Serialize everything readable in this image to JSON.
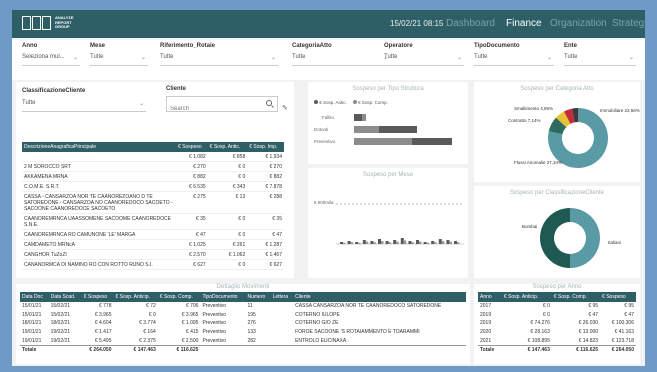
{
  "header": {
    "date": "15/02/21 08:15",
    "nav": [
      "Dashboard",
      "Finance",
      "Organization",
      "Strategy"
    ],
    "logo_line1": "ANALYZE",
    "logo_line2": "REPORT",
    "logo_line3": "GROUP"
  },
  "filters": [
    {
      "label": "Anno",
      "value": "Seleziona mul..."
    },
    {
      "label": "Mese",
      "value": "Tutte"
    },
    {
      "label": "Riferimento_Rotaie",
      "value": "Tutte"
    },
    {
      "label": "CategoriaAtto",
      "value": "Tutte"
    },
    {
      "label": "Operatore",
      "value": "Tutte"
    },
    {
      "label": "TipoDocumento",
      "value": "Tutte"
    },
    {
      "label": "Ente",
      "value": "Tutte"
    }
  ],
  "classificazione": {
    "label": "ClassificazioneCliente",
    "value": "Tutte"
  },
  "cliente": {
    "label": "Cliente",
    "placeholder": "Search"
  },
  "table1": {
    "headers": [
      "DescrizioneAnagraficaPrincipale",
      "€ Sospeso",
      "€ Sosp. Antic.",
      "€ Sosp. Imp."
    ],
    "rows": [
      [
        "",
        "€ 1.082",
        "€ 858",
        "€ 1.934"
      ],
      [
        "2 M SOROCCO SRT",
        "€ 270",
        "€ 0",
        "€ 270"
      ],
      [
        "AKKAMENA MRNA",
        "€ 882",
        "€ 0",
        "€ 882"
      ],
      [
        "C.O.M.E. S.R.T.",
        "€ 6.535",
        "€ 343",
        "€ 7.878"
      ],
      [
        "CASSA - CANSARZOA NOR TE CAANOREZOANO D TE SATOREDONE - CANSARZOA NO CAANOREDOCO SACOETO - SACOONE CAANOREDOCE SACOETO",
        "€ 275",
        "€ 13",
        "€ 288"
      ],
      [
        "CAANOREMRNCA UAASSOMENE SACOOME CAANOREDOCE S.N.E.",
        "€ 35",
        "€ 0",
        "€ 35"
      ],
      [
        "CAANOREMRNCA RO CAMUNONE 'LE' MARGA",
        "€ 47",
        "€ 0",
        "€ 47"
      ],
      [
        "CAMDAMETO MRNcA",
        "€ 1.025",
        "€ 261",
        "€ 1.287"
      ],
      [
        "CANGHOR TuZoZI",
        "€ 2.570",
        "€ 1.062",
        "€ 1.467"
      ],
      [
        "CANANORMCA DI NAMINO RO CON ROTTO RUNO S.I.",
        "€ 627",
        "€ 0",
        "€ 627"
      ]
    ]
  },
  "tipo_struttura": {
    "title": "Sospeso per Tipo Struttura",
    "legend": [
      "€ Sosp. Antic.",
      "€ Sosp. Comp."
    ],
    "colors": [
      "#5a5a5a",
      "#8c8c8c"
    ]
  },
  "categoria_atto": {
    "title": "Sospeso per Categoria Atto",
    "labels": [
      "Smaltimento 4,85%",
      "Immobiliare 22,56%",
      "Contratto 7,14%",
      "Flussi Anomalie 27,34%"
    ]
  },
  "mese": {
    "title": "Sospeso per Mese",
    "ylabel": "€ 500mila"
  },
  "classificazione_chart": {
    "title": "Sospeso per ClassificazioneCliente",
    "labels": [
      "Bombai",
      "Italiani"
    ]
  },
  "dettaglio": {
    "title": "Dettaglio Movimenti",
    "headers": [
      "Data Doc",
      "Data Scad.",
      "€ Sospeso",
      "€ Sosp. Anticip.",
      "€ Sosp. Comp.",
      "TipoDocumento",
      "Numero",
      "Lettera",
      "Cliente"
    ],
    "rows": [
      [
        "15/01/21",
        "15/02/21",
        "€ 778",
        "€ 72",
        "€ 706",
        "Preventivo",
        "11",
        "",
        "CASSA CANSARZOA NOR TE CAANOREDOCO SATOREDONE"
      ],
      [
        "15/01/21",
        "15/02/21",
        "€ 3.965",
        "€ 0",
        "€ 3.965",
        "Preventivo",
        "195",
        "",
        "COTERNO IULOPE"
      ],
      [
        "18/01/21",
        "18/02/21",
        "€ 4.604",
        "€ 3.774",
        "€ 1.095",
        "Preventivo",
        "276",
        "",
        "COTERNO GIO ZE"
      ],
      [
        "19/01/21",
        "19/02/21",
        "€ 1.417",
        "€ 164",
        "€ 415",
        "Preventivo",
        "133",
        "",
        "FOROE SACOONE 'S ROTAIAMMENTO E TOARAMMI"
      ],
      [
        "19/01/21",
        "19/02/21",
        "€ 5.495",
        "€ 2.375",
        "€ 2.500",
        "Preventivo",
        "282",
        "",
        "ENTROLO EUCINAXA"
      ]
    ],
    "total": [
      "Totale",
      "",
      "€ 264.050",
      "€ 147.463",
      "€ 116.625",
      "",
      "",
      "",
      ""
    ]
  },
  "anno": {
    "title": "Sospeso per Anno",
    "headers": [
      "Anno",
      "€ Sosp. Anticip.",
      "€ Sosp. Comp.",
      "€ Sospeso"
    ],
    "rows": [
      [
        "2017",
        "€ 0",
        "€ 95",
        "€ 95"
      ],
      [
        "2019",
        "€ 0",
        "€ 47",
        "€ 47"
      ],
      [
        "2019",
        "€ 74.276",
        "€ 26.030",
        "€ 100.306"
      ],
      [
        "2020",
        "€ 28.163",
        "€ 13.000",
        "€ 41.163"
      ],
      [
        "2021",
        "€ 108.895",
        "€ 14.823",
        "€ 123.718"
      ]
    ],
    "total": [
      "Totale",
      "€ 147.463",
      "€ 116.625",
      "€ 264.050"
    ]
  }
}
